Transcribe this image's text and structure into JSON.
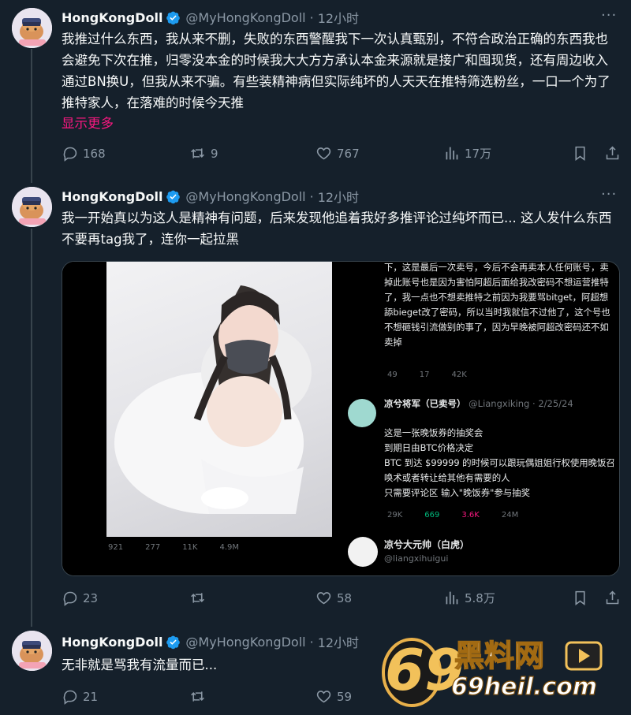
{
  "colors": {
    "background": "#15202b",
    "text": "#f7f9f9",
    "muted": "#8b98a5",
    "accent_pink": "#f91880",
    "verified_blue": "#1d9bf0",
    "divider": "#38444d"
  },
  "tweets": [
    {
      "name": "HongKongDoll",
      "handle": "@MyHongKongDoll",
      "time": "12小时",
      "text": "我推过什么东西，我从来不删，失败的东西警醒我下一次认真甄别，不符合政治正确的东西我也会避免下次在推，归零没本金的时候我大大方方承认本金来源就是接广和囤现货，还有周边收入通过BN换U，但我从来不骗。有些装精神病但实际纯坏的人天天在推特筛选粉丝，一口一个为了推特家人，在落难的时候今天推",
      "show_more": "显示更多",
      "replies": "168",
      "retweets": "9",
      "likes": "767",
      "views": "17万"
    },
    {
      "name": "HongKongDoll",
      "handle": "@MyHongKongDoll",
      "time": "12小时",
      "text": "我一开始真以为这人是精神有问题，后来发现他追着我好多推评论过纯坏而已... 这人发什么东西不要再tag我了，连你一起拉黑",
      "replies": "23",
      "retweets": "",
      "likes": "58",
      "views": "5.8万",
      "media": {
        "left_stats": [
          "921",
          "277",
          "11K",
          "4.9M"
        ],
        "right_top_text": "下，这是最后一次卖号，今后不会再卖本人任何账号，卖掉此账号也是因为害怕阿超后面给我改密码不想运营推特了，我一点也不想卖推特之前因为我要骂bitget，阿超想舔bieget改了密码，所以当时我就信不过他了，这个号也不想砸钱引流做别的事了，因为早晚被阿超改密码还不如卖掉",
        "right_top_stats": [
          "49",
          "17",
          "42K"
        ],
        "quoted_name": "凉兮将军（已卖号）",
        "quoted_handle": "@Liangxiking",
        "quoted_date": "2/25/24",
        "quoted_text": "这是一张晚饭券的抽奖会\n到期日由BTC价格决定\nBTC 到达 $99999 的时候可以跟玩偶姐姐行权使用晚饭召唤术或者转让给其他有需要的人\n只需要评论区 输入\"晚饭券\"参与抽奖",
        "quoted_stats": [
          "29K",
          "669",
          "3.6K",
          "24M"
        ],
        "author_name": "凉兮大元帅（白虎）",
        "author_handle": "@liangxihuigui"
      }
    },
    {
      "name": "HongKongDoll",
      "handle": "@MyHongKongDoll",
      "time": "12小时",
      "text": "无非就是骂我有流量而已...",
      "replies": "21",
      "retweets": "",
      "likes": "59",
      "views": ""
    }
  ],
  "watermark": {
    "brand": "69黑料网",
    "site": "69heil.com"
  }
}
